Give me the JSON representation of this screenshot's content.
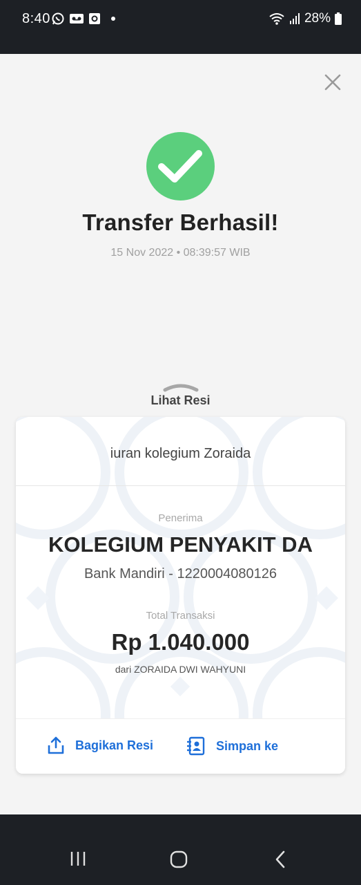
{
  "status_bar": {
    "time": "8:40",
    "battery": "28%",
    "icons": [
      "whatsapp-icon",
      "voicemail-icon",
      "screenshot-icon",
      "dot-icon",
      "wifi-icon",
      "signal-icon",
      "battery-icon"
    ]
  },
  "header": {
    "close_icon": "close-icon"
  },
  "success": {
    "title": "Transfer Berhasil!",
    "datetime": "15 Nov 2022 • 08:39:57 WIB",
    "color": "#5bcf7d"
  },
  "receipt": {
    "toggle_label": "Lihat Resi",
    "note": "iuran kolegium Zoraida",
    "recipient_label": "Penerima",
    "recipient_name": "KOLEGIUM PENYAKIT DA",
    "recipient_bank": "Bank Mandiri - 1220004080126",
    "total_label": "Total Transaksi",
    "total_amount": "Rp 1.040.000",
    "sender": "dari ZORAIDA DWI WAHYUNI"
  },
  "actions": {
    "share_label": "Bagikan Resi",
    "save_label": "Simpan ke",
    "accent_color": "#1e6fd9"
  },
  "nav": {
    "buttons": [
      "recent-apps-icon",
      "home-icon",
      "back-icon"
    ]
  }
}
